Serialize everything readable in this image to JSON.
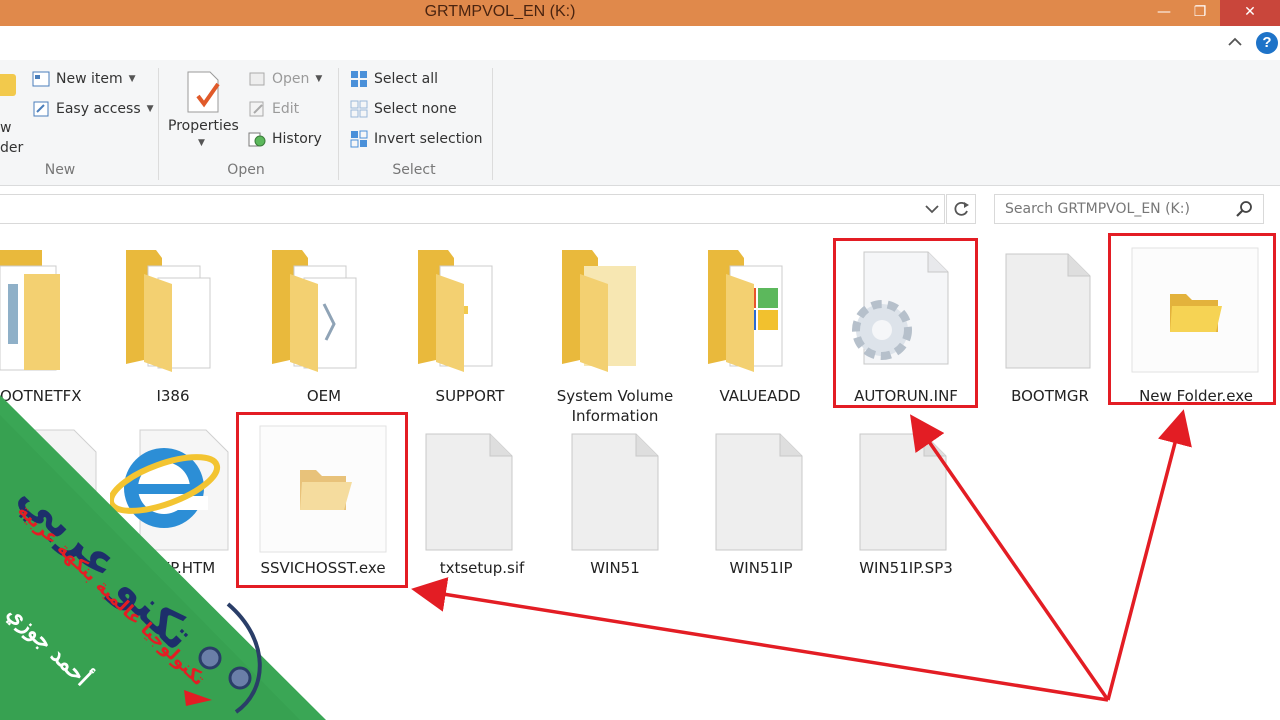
{
  "window": {
    "title": "GRTMPVOL_EN (K:)",
    "controls": {
      "minimize": "—",
      "restore": "❐",
      "close": "✕"
    }
  },
  "ribbon": {
    "help": "?",
    "groups": {
      "new": {
        "label": "New",
        "folder_label_line1": "w",
        "folder_label_line2": "der",
        "new_item": "New item",
        "easy_access": "Easy access"
      },
      "open": {
        "label": "Open",
        "properties": "Properties",
        "open": "Open",
        "edit": "Edit",
        "history": "History"
      },
      "select": {
        "label": "Select",
        "select_all": "Select all",
        "select_none": "Select none",
        "invert_selection": "Invert selection"
      }
    }
  },
  "address": {
    "search_placeholder": "Search GRTMPVOL_EN (K:)"
  },
  "files_row1": [
    {
      "name": "OOTNETFX",
      "kind": "folder-docs"
    },
    {
      "name": "I386",
      "kind": "folder-docs"
    },
    {
      "name": "OEM",
      "kind": "folder-docs"
    },
    {
      "name": "SUPPORT",
      "kind": "folder-open"
    },
    {
      "name": "System Volume",
      "name2": "Information",
      "kind": "folder-empty"
    },
    {
      "name": "VALUEADD",
      "kind": "folder-windows"
    },
    {
      "name": "AUTORUN.INF",
      "kind": "settings-file"
    },
    {
      "name": "BOOTMGR",
      "kind": "file"
    },
    {
      "name": "New Folder.exe",
      "kind": "exe-folder"
    }
  ],
  "files_row2": [
    {
      "name": "",
      "kind": "file"
    },
    {
      "name": "XP.HTM",
      "kind": "ie-file"
    },
    {
      "name": "SSVICHOSST.exe",
      "kind": "exe-folder"
    },
    {
      "name": "txtsetup.sif",
      "kind": "file"
    },
    {
      "name": "WIN51",
      "kind": "file"
    },
    {
      "name": "WIN51IP",
      "kind": "file"
    },
    {
      "name": "WIN51IP.SP3",
      "kind": "file"
    }
  ],
  "watermark": {
    "brand": "تكنو عربي",
    "tagline": "تكنولوجيا عالمية بنكهة عربية",
    "author": "أحمد جوزي",
    "color": "#3aa655"
  },
  "colors": {
    "titlebar": "#e0894b",
    "annotation": "#e31d24",
    "folder": "#f2c94c"
  }
}
